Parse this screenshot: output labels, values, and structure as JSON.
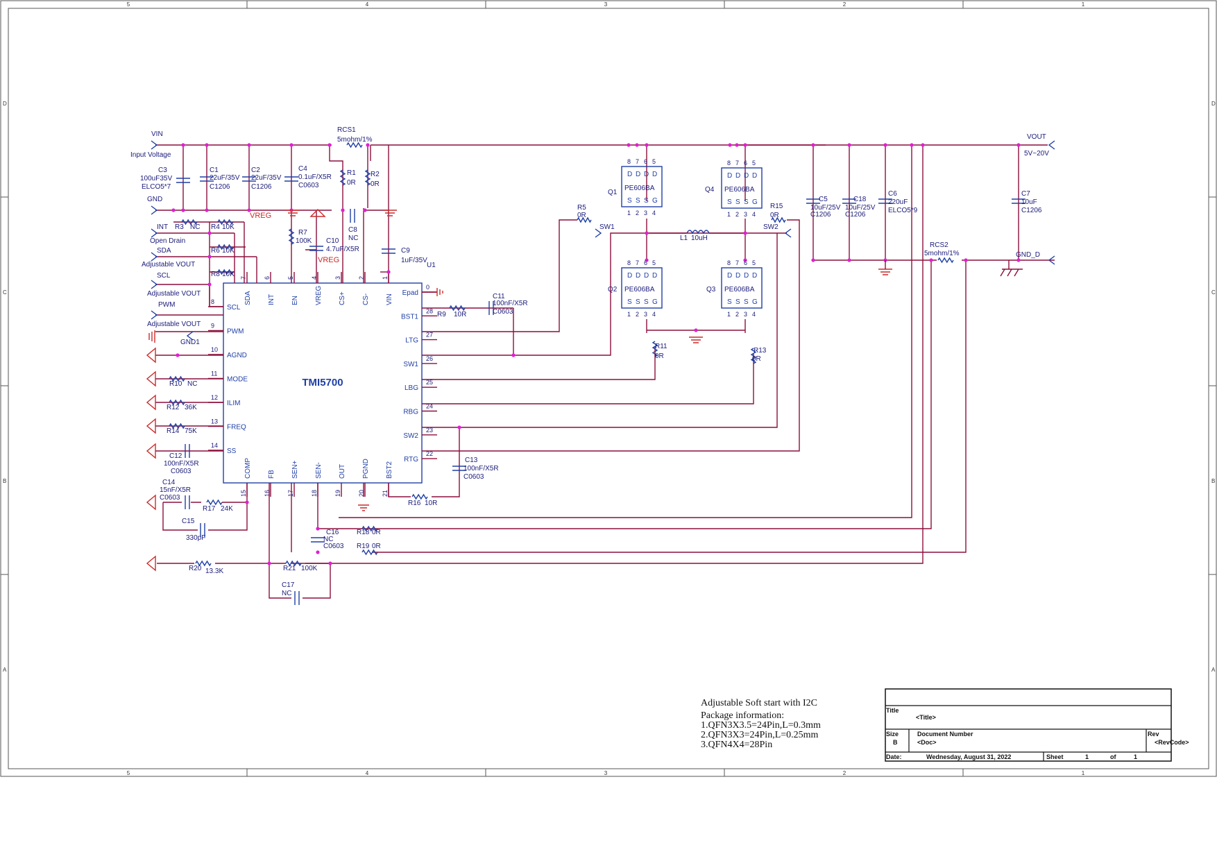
{
  "ic": {
    "ref": "U1",
    "part": "TMI5700"
  },
  "ic_pins_left": [
    {
      "num": "8",
      "name": "SCL"
    },
    {
      "num": "9",
      "name": "PWM"
    },
    {
      "num": "10",
      "name": "AGND"
    },
    {
      "num": "11",
      "name": "MODE"
    },
    {
      "num": "12",
      "name": "ILIM"
    },
    {
      "num": "13",
      "name": "FREQ"
    },
    {
      "num": "14",
      "name": "SS"
    }
  ],
  "ic_pins_right": [
    {
      "num": "0",
      "name": "Epad"
    },
    {
      "num": "28",
      "name": "BST1"
    },
    {
      "num": "27",
      "name": "LTG"
    },
    {
      "num": "26",
      "name": "SW1"
    },
    {
      "num": "25",
      "name": "LBG"
    },
    {
      "num": "24",
      "name": "RBG"
    },
    {
      "num": "23",
      "name": "SW2"
    },
    {
      "num": "22",
      "name": "RTG"
    }
  ],
  "ic_pins_top": [
    {
      "num": "7",
      "name": "SDA"
    },
    {
      "num": "6",
      "name": "INT"
    },
    {
      "num": "5",
      "name": "EN"
    },
    {
      "num": "4",
      "name": "VREG"
    },
    {
      "num": "3",
      "name": "CS+"
    },
    {
      "num": "2",
      "name": "CS-"
    },
    {
      "num": "1",
      "name": "VIN"
    }
  ],
  "ic_pins_bottom": [
    {
      "num": "15",
      "name": "COMP"
    },
    {
      "num": "16",
      "name": "FB"
    },
    {
      "num": "17",
      "name": "SEN+"
    },
    {
      "num": "18",
      "name": "SEN-"
    },
    {
      "num": "19",
      "name": "OUT"
    },
    {
      "num": "20",
      "name": "PGND"
    },
    {
      "num": "21",
      "name": "BST2"
    }
  ],
  "ports": {
    "vin": "VIN",
    "vin_desc": "Input Voltage",
    "gnd": "GND",
    "int": "INT",
    "int_desc": "Open Drain",
    "sda": "SDA",
    "sda_desc": "Adjustable VOUT",
    "scl": "SCL",
    "scl_desc": "Adjustable VOUT",
    "pwm": "PWM",
    "pwm_desc": "Adjustable VOUT",
    "gnd1": "GND1",
    "vout": "VOUT",
    "vout_desc": "5V~20V",
    "gnd_d": "GND_D",
    "sw1": "SW1",
    "sw2": "SW2",
    "vreg": "VREG"
  },
  "components": {
    "rcs1": [
      "RCS1",
      "5mohm/1%"
    ],
    "rcs2": [
      "RCS2",
      "5mohm/1%"
    ],
    "c3": [
      "C3",
      "100uF35V",
      "ELCO5*7"
    ],
    "c1": [
      "C1",
      "22uF/35V",
      "C1206"
    ],
    "c2": [
      "C2",
      "22uF/35V",
      "C1206"
    ],
    "c4": [
      "C4",
      "0.1uF/X5R",
      "C0603"
    ],
    "r1": [
      "R1",
      "0R"
    ],
    "r2": [
      "R2",
      "0R"
    ],
    "r3": [
      "R3",
      "NC"
    ],
    "r4": [
      "R4",
      "10K"
    ],
    "r6": [
      "R6",
      "10K"
    ],
    "r8": [
      "R8",
      "10K"
    ],
    "r7": [
      "R7",
      "100K"
    ],
    "c10": [
      "C10",
      "4.7uF/X5R"
    ],
    "c8": [
      "C8",
      "NC"
    ],
    "c9": [
      "C9",
      "1uF/35V"
    ],
    "c11": [
      "C11",
      "100nF/X5R",
      "C0603"
    ],
    "r9": [
      "R9",
      "10R"
    ],
    "r5": [
      "R5",
      "0R"
    ],
    "r15": [
      "R15",
      "0R"
    ],
    "q1": [
      "Q1",
      "PE606BA"
    ],
    "q2": [
      "Q2",
      "PE606BA"
    ],
    "q3": [
      "Q3",
      "PE606BA"
    ],
    "q4": [
      "Q4",
      "PE606BA"
    ],
    "l1": [
      "L1",
      "10uH"
    ],
    "r11": [
      "R11",
      "0R"
    ],
    "r13": [
      "R13",
      "0R"
    ],
    "c5": [
      "C5",
      "10uF/25V",
      "C1206"
    ],
    "c18": [
      "C18",
      "10uF/25V",
      "C1206"
    ],
    "c6": [
      "C6",
      "220uF",
      "ELCO5*9"
    ],
    "c7": [
      "C7",
      "10uF",
      "C1206"
    ],
    "r10": [
      "R10",
      "NC"
    ],
    "r12": [
      "R12",
      "36K"
    ],
    "r14": [
      "R14",
      "75K"
    ],
    "c12": [
      "C12",
      "100nF/X5R",
      "C0603"
    ],
    "c14": [
      "C14",
      "15nF/X5R",
      "C0603"
    ],
    "r17": [
      "R17",
      "24K"
    ],
    "c15": [
      "C15",
      "330pF"
    ],
    "r16": [
      "R16",
      "10R"
    ],
    "c13": [
      "C13",
      "100nF/X5R",
      "C0603"
    ],
    "c16": [
      "C16",
      "NC",
      "C0603"
    ],
    "r18": [
      "R18",
      "0R"
    ],
    "r19": [
      "R19",
      "0R"
    ],
    "r20": [
      "R20",
      "13.3K"
    ],
    "r21": [
      "R21",
      "100K"
    ],
    "c17": [
      "C17",
      "NC"
    ]
  },
  "notes": [
    "Adjustable Soft start with I2C",
    "Package information:",
    "1.QFN3X3.5=24Pin,L=0.3mm",
    "2.QFN3X3=24Pin,L=0.25mm",
    "3.QFN4X4=28Pin"
  ],
  "title_block": {
    "title_label": "Title",
    "title_value": "<Title>",
    "size_label": "Size",
    "size_value": "B",
    "docnum_label": "Document Number",
    "docnum_value": "<Doc>",
    "rev_label": "Rev",
    "rev_value": "<RevCode>",
    "date_label": "Date:",
    "date_value": "Wednesday, August 31, 2022",
    "sheet_label": "Sheet",
    "sheet_value": "1",
    "of_label": "of",
    "of_value": "1"
  },
  "border": {
    "cols": [
      "5",
      "4",
      "3",
      "2",
      "1"
    ],
    "rows": [
      "D",
      "C",
      "B",
      "A"
    ]
  }
}
